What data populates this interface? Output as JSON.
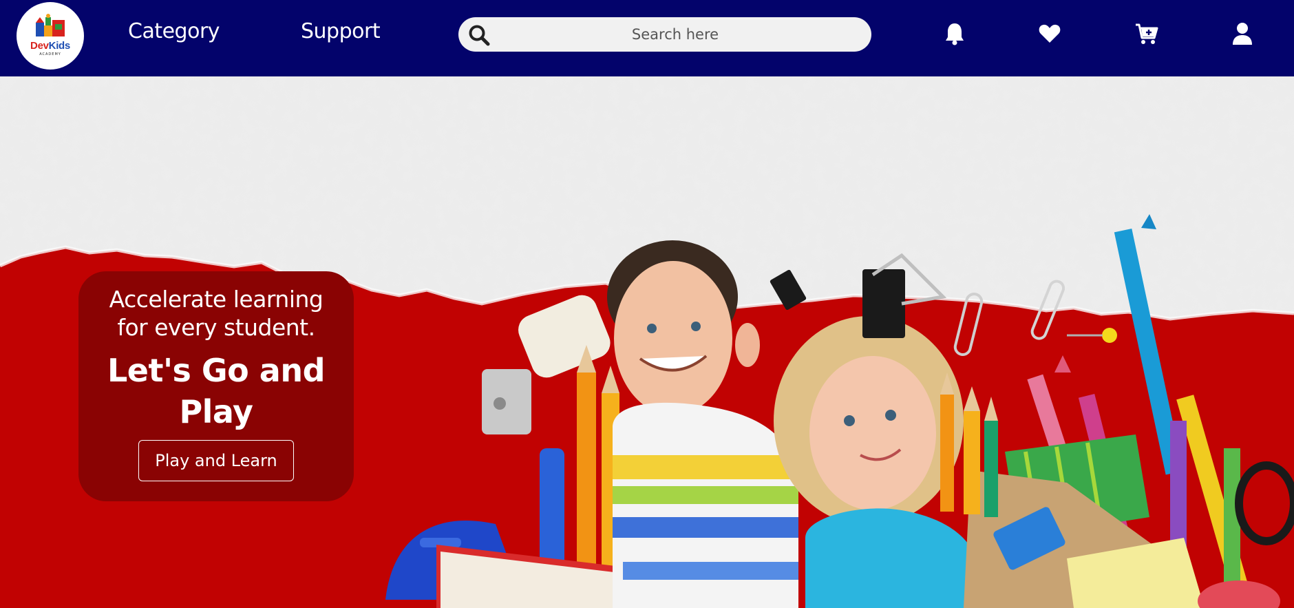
{
  "brand": {
    "logo_dev": "Dev",
    "logo_kids": "Kids",
    "logo_sub": "ACADEMY",
    "colors": {
      "navbar": "#03036b",
      "hero_red": "#c10202",
      "card": "#8a0303"
    }
  },
  "nav": {
    "links": [
      {
        "label": "Category"
      },
      {
        "label": "Support"
      }
    ],
    "search": {
      "placeholder": "Search here",
      "icon": "search-icon"
    },
    "icons": [
      "bell-icon",
      "heart-icon",
      "cart-icon",
      "user-icon"
    ]
  },
  "hero": {
    "subtitle_line1": "Accelerate learning",
    "subtitle_line2": "for every student.",
    "title_line1": "Let's Go and",
    "title_line2": "Play",
    "button_label": "Play and Learn",
    "image": "kids-with-school-supplies-photo"
  }
}
